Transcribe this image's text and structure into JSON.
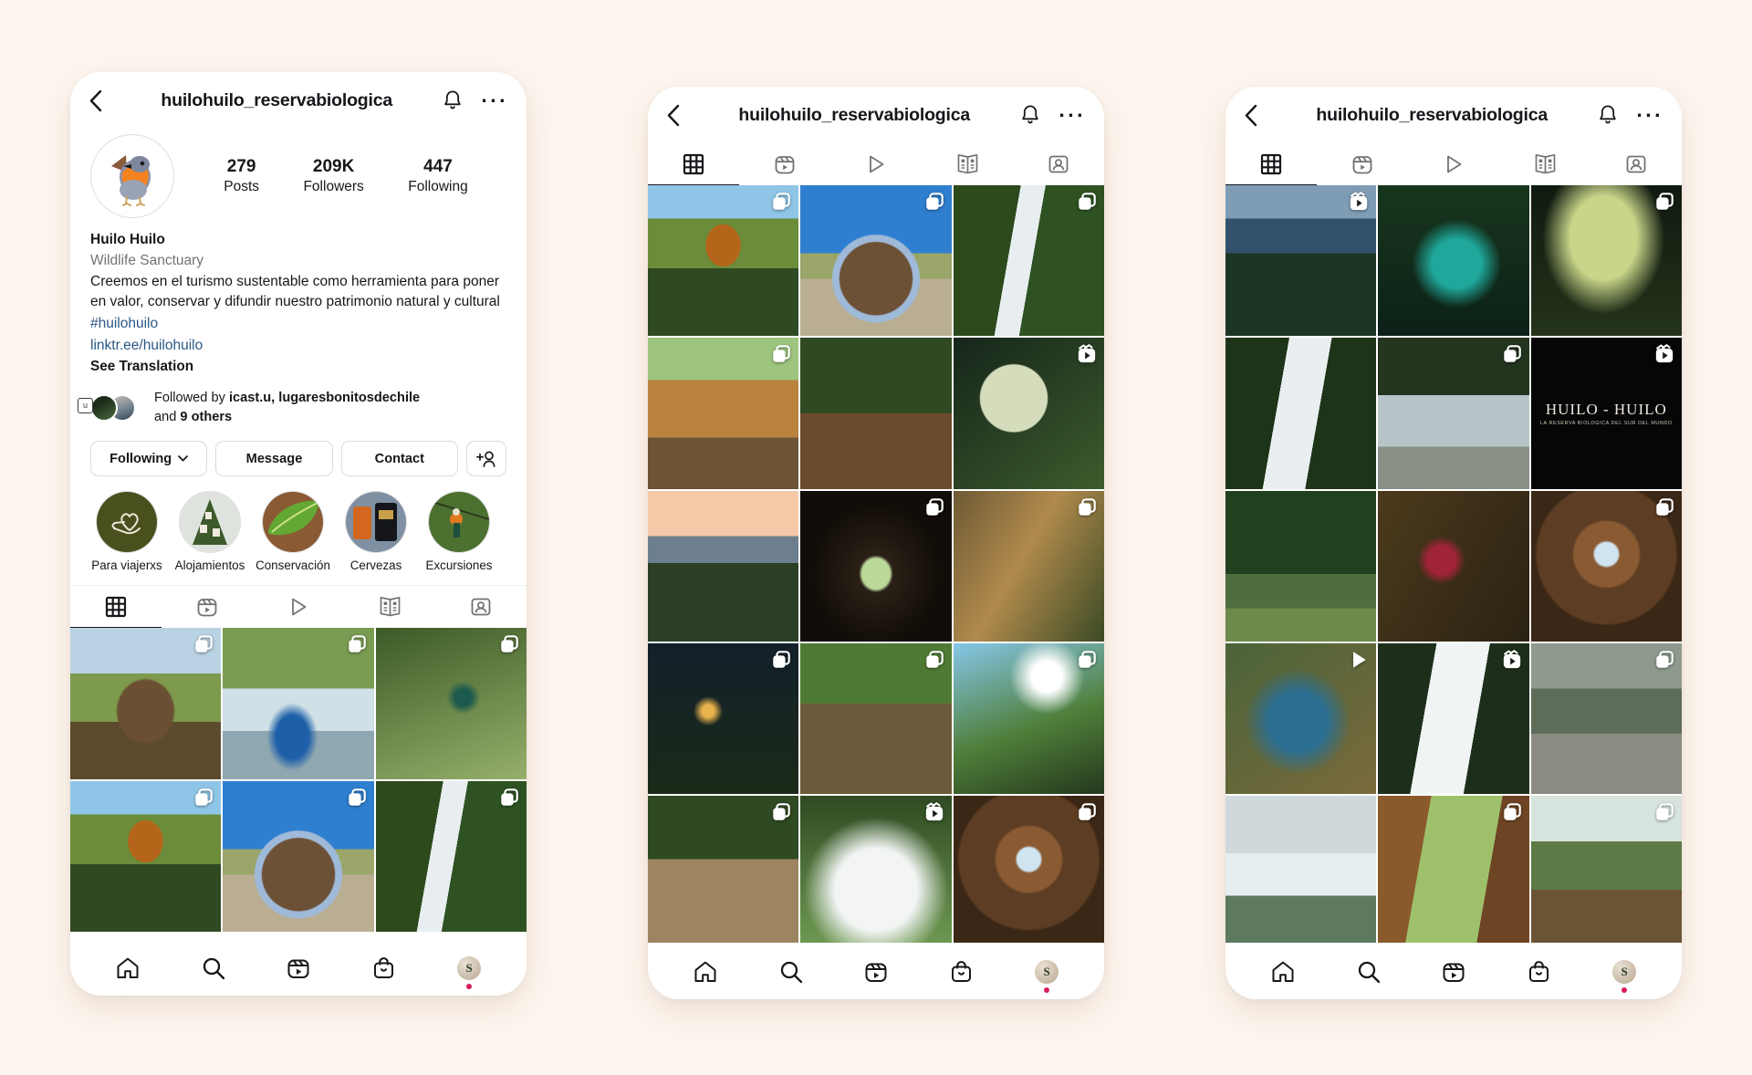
{
  "app": "instagram-profile",
  "background_color": "#fdf5ee",
  "accent_color": "#2a5885",
  "header": {
    "back_icon": "chevron-left-icon",
    "title": "huilohuilo_reservabiologica",
    "bell_icon": "bell-icon",
    "more_icon": "ellipsis-icon"
  },
  "profile": {
    "avatar_icon": "robin-bird-avatar",
    "stats": [
      {
        "value": "279",
        "label": "Posts"
      },
      {
        "value": "209K",
        "label": "Followers"
      },
      {
        "value": "447",
        "label": "Following"
      }
    ],
    "name": "Huilo Huilo",
    "category": "Wildlife Sanctuary",
    "bio_line_1": "Creemos en el turismo sustentable como herramienta para poner",
    "bio_line_2": "en valor, conservar y difundir nuestro patrimonio natural y cultural",
    "hashtag": "#huilohuilo",
    "link": "linktr.ee/huilohuilo",
    "translate": "See Translation",
    "followed_by_prefix": "Followed by ",
    "followed_by_names": "icast.u, lugaresbonitosdechile",
    "followed_by_suffix_pre": "and ",
    "followed_by_count": "9 others",
    "badge_glyph": "u"
  },
  "actions": [
    {
      "label": "Following",
      "name": "following-button",
      "chevron": true
    },
    {
      "label": "Message",
      "name": "message-button",
      "chevron": false
    },
    {
      "label": "Contact",
      "name": "contact-button",
      "chevron": false
    }
  ],
  "add_person_icon": "add-person-icon",
  "highlights": [
    {
      "label": "Para viajerxs",
      "art": "hl-heart"
    },
    {
      "label": "Alojamientos",
      "art": "hl-cabins"
    },
    {
      "label": "Conservación",
      "art": "hl-leaf"
    },
    {
      "label": "Cervezas",
      "art": "hl-beer"
    },
    {
      "label": "Excursiones",
      "art": "hl-zip"
    }
  ],
  "tabs": [
    {
      "name": "tab-grid",
      "icon": "grid-icon",
      "active": true
    },
    {
      "name": "tab-reels",
      "icon": "reels-icon",
      "active": false
    },
    {
      "name": "tab-video",
      "icon": "play-outline-icon",
      "active": false
    },
    {
      "name": "tab-guides",
      "icon": "book-icon",
      "active": false
    },
    {
      "name": "tab-tagged",
      "icon": "tagged-person-icon",
      "active": false
    }
  ],
  "bottom_nav": [
    {
      "name": "nav-home",
      "icon": "home-icon"
    },
    {
      "name": "nav-search",
      "icon": "search-icon"
    },
    {
      "name": "nav-reels",
      "icon": "reels-icon"
    },
    {
      "name": "nav-shop",
      "icon": "shop-bag-icon"
    },
    {
      "name": "nav-profile",
      "icon": "avatar-icon",
      "letter": "S",
      "has_notification_dot": true
    }
  ],
  "grids": {
    "phone1": [
      {
        "art": "p-gate",
        "badge": "carousel"
      },
      {
        "art": "p-raft",
        "badge": "carousel"
      },
      {
        "art": "p-zip",
        "badge": "carousel"
      },
      {
        "art": "p-lodge",
        "badge": "carousel"
      },
      {
        "art": "p-arch",
        "badge": "carousel"
      },
      {
        "art": "p-fall1",
        "badge": "carousel"
      }
    ],
    "phone2": [
      {
        "art": "p-lodge",
        "badge": "carousel"
      },
      {
        "art": "p-arch",
        "badge": "carousel"
      },
      {
        "art": "p-fall1",
        "badge": "carousel"
      },
      {
        "art": "p-cabin",
        "badge": "carousel"
      },
      {
        "art": "p-boardwalk",
        "badge": "none"
      },
      {
        "art": "p-moss",
        "badge": "reels"
      },
      {
        "art": "p-mountain",
        "badge": "none"
      },
      {
        "art": "p-tunnel",
        "badge": "carousel"
      },
      {
        "art": "p-deer",
        "badge": "carousel"
      },
      {
        "art": "p-night",
        "badge": "carousel"
      },
      {
        "art": "p-trail",
        "badge": "carousel"
      },
      {
        "art": "p-canopy",
        "badge": "carousel"
      },
      {
        "art": "p-shelter",
        "badge": "carousel"
      },
      {
        "art": "p-spray",
        "badge": "reels"
      },
      {
        "art": "p-spiral",
        "badge": "carousel"
      }
    ],
    "phone3": [
      {
        "art": "p-valley",
        "badge": "reels"
      },
      {
        "art": "p-lagoon",
        "badge": "none"
      },
      {
        "art": "p-leaves",
        "badge": "carousel"
      },
      {
        "art": "p-bigfall",
        "badge": "none"
      },
      {
        "art": "p-thermal",
        "badge": "carousel"
      },
      {
        "art": "p-logo",
        "badge": "reels",
        "logo_main": "HUILO - HUILO",
        "logo_sub": "LA RESERVA BIOLOGICA DEL SUR DEL MUNDO"
      },
      {
        "art": "p-pond",
        "badge": "none"
      },
      {
        "art": "p-girls",
        "badge": "none"
      },
      {
        "art": "p-spiral",
        "badge": "carousel"
      },
      {
        "art": "p-river",
        "badge": "play"
      },
      {
        "art": "p-fall2",
        "badge": "reels"
      },
      {
        "art": "p-walker",
        "badge": "carousel"
      },
      {
        "art": "p-cascade",
        "badge": "none"
      },
      {
        "art": "p-window",
        "badge": "carousel"
      },
      {
        "art": "p-path",
        "badge": "carousel"
      }
    ]
  }
}
